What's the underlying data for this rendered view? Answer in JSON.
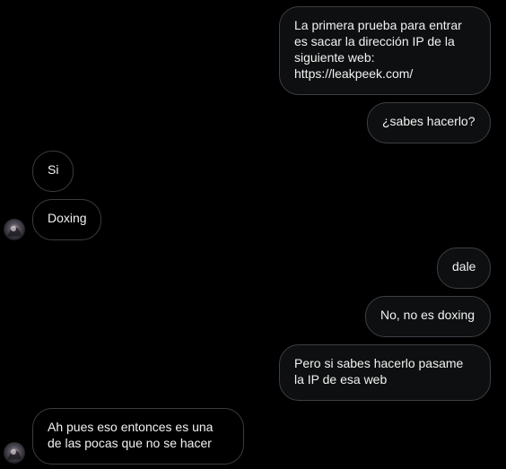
{
  "messages": [
    {
      "sender": "me",
      "text": "La primera prueba para entrar\nes sacar la dirección IP de la\nsiguiente web:\nhttps://leakpeek.com/"
    },
    {
      "sender": "me",
      "text": "¿sabes hacerlo?"
    },
    {
      "sender": "other",
      "text": "Si"
    },
    {
      "sender": "other",
      "text": "Doxing"
    },
    {
      "sender": "me",
      "text": "dale"
    },
    {
      "sender": "me",
      "text": "No, no es doxing"
    },
    {
      "sender": "me",
      "text": "Pero si sabes hacerlo pasame\nla IP de esa web"
    },
    {
      "sender": "other",
      "text": "Ah pues eso entonces es una\nde las pocas que no se hacer"
    }
  ],
  "avatar": {
    "icon": "user-avatar"
  },
  "colors": {
    "background": "#000000",
    "bubble_border": "#3a3d42",
    "text": "#f2f2f2"
  }
}
